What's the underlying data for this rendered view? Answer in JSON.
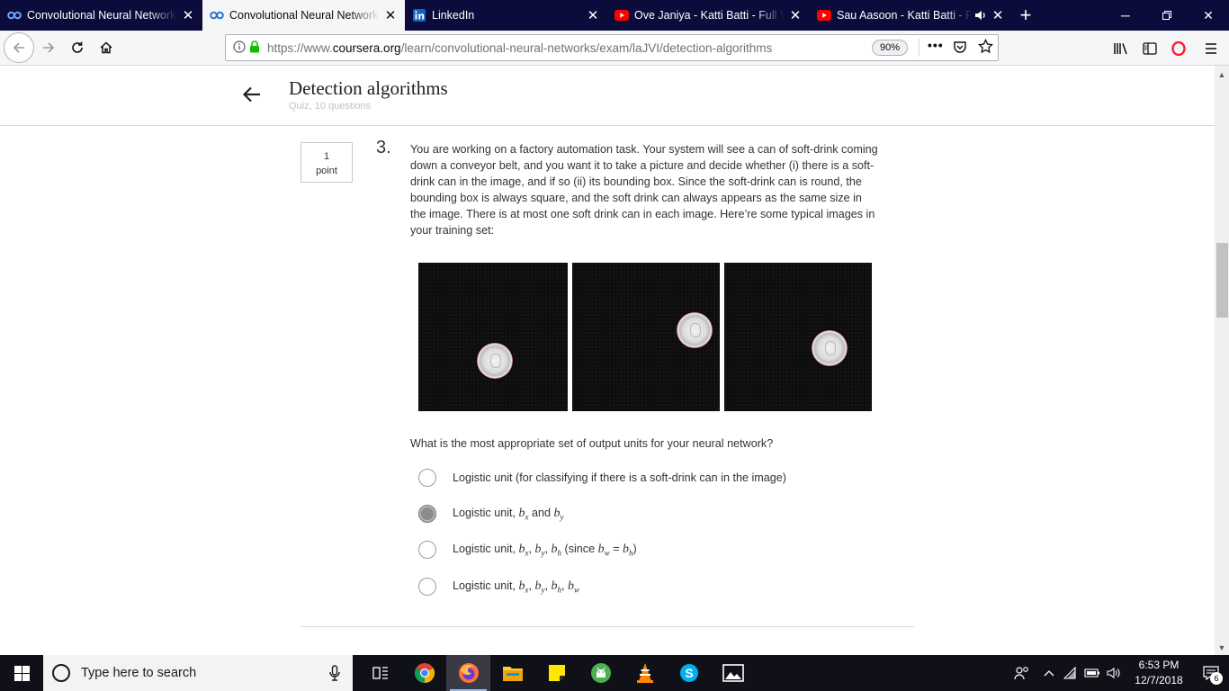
{
  "browser": {
    "tabs": [
      {
        "title": "Convolutional Neural Network",
        "icon": "coursera-icon",
        "active": false
      },
      {
        "title": "Convolutional Neural Network",
        "icon": "coursera-icon",
        "active": true
      },
      {
        "title": "LinkedIn",
        "icon": "linkedin-icon",
        "active": false
      },
      {
        "title": "Ove Janiya - Katti Batti - Full Vi",
        "icon": "youtube-icon",
        "active": false
      },
      {
        "title": "Sau Aasoon - Katti Batti - Fu",
        "icon": "youtube-icon",
        "active": false,
        "audio": true
      }
    ],
    "url_prefix": "https://www.",
    "url_domain": "coursera.org",
    "url_path": "/learn/convolutional-neural-networks/exam/laJVI/detection-algorithms",
    "zoom": "90%"
  },
  "page": {
    "title": "Detection algorithms",
    "subtitle": "Quiz, 10 questions",
    "question": {
      "points_value": "1",
      "points_label": "point",
      "number": "3.",
      "text": "You are working on a factory automation task. Your system will see a can of soft-drink coming down a conveyor belt, and you want it to take a picture and decide whether (i) there is a soft-drink can in the image, and if so (ii) its bounding box. Since the soft-drink can is round, the bounding box is always square, and the soft drink can always appears as the same size in the image. There is at most one soft drink can in each image. Here’re some typical images in your training set:",
      "prompt": "What is the most appropriate set of output units for your neural network?",
      "options": [
        {
          "text": "Logistic unit (for classifying if there is a soft-drink can in the image)",
          "selected": false
        },
        {
          "text": "Logistic unit, b_x and b_y",
          "selected": true
        },
        {
          "text": "Logistic unit, b_x, b_y, b_h (since b_w = b_h)",
          "selected": false
        },
        {
          "text": "Logistic unit, b_x, b_y, b_h, b_w",
          "selected": false
        }
      ],
      "option_parts": {
        "o1": "Logistic unit (for classifying if there is a soft-drink can in the image)",
        "o2_pre": "Logistic unit, ",
        "o2_and": " and ",
        "o3_pre": "Logistic unit, ",
        "o3_since": " (since ",
        "o3_eq": " = ",
        "o3_close": ")",
        "o4_pre": "Logistic unit, ",
        "b": "b",
        "x": "x",
        "y": "y",
        "h": "h",
        "w": "w",
        "comma": ", "
      }
    }
  },
  "taskbar": {
    "search_placeholder": "Type here to search",
    "time": "6:53 PM",
    "date": "12/7/2018",
    "notification_count": "6",
    "apps": [
      "task-view-icon",
      "chrome-icon",
      "firefox-icon",
      "file-explorer-icon",
      "sticky-notes-icon",
      "android-icon",
      "vlc-icon",
      "skype-icon",
      "photos-icon"
    ]
  },
  "colors": {
    "tabbar_bg": "#0c0c3c",
    "active_tab_bg": "#f5f6f7",
    "selected_radio": "#8c8c8c",
    "taskbar_bg": "#101018"
  }
}
